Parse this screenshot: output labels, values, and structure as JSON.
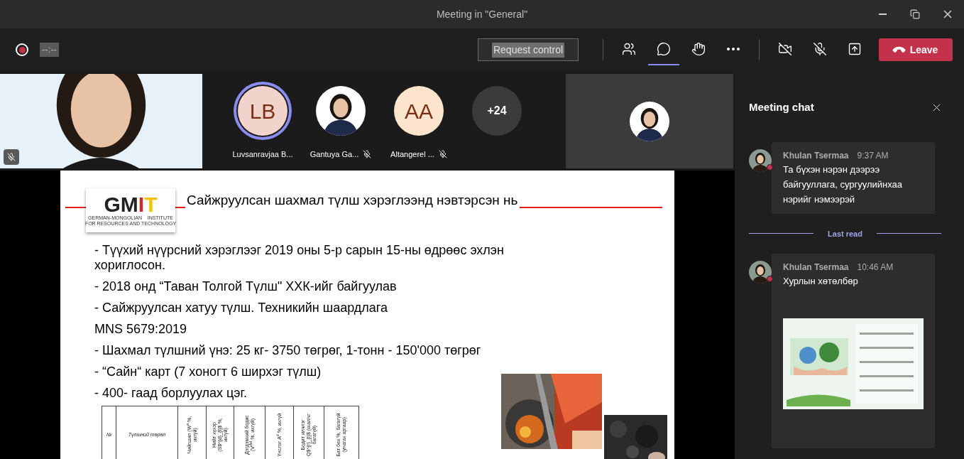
{
  "window": {
    "title": "Meeting in \"General\""
  },
  "toolbar": {
    "recording": true,
    "timer": "--:--",
    "request_control": "Request control",
    "buttons": [
      {
        "kind": "people",
        "selected": false
      },
      {
        "kind": "chat",
        "selected": true
      },
      {
        "kind": "reactions",
        "selected": false
      },
      {
        "kind": "more",
        "selected": false
      },
      {
        "kind": "camera-off",
        "selected": false
      },
      {
        "kind": "mic-off",
        "selected": false
      },
      {
        "kind": "share",
        "selected": false
      }
    ],
    "leave": "Leave"
  },
  "participants": [
    {
      "kind": "video",
      "muted": true
    },
    {
      "kind": "initials",
      "initials": "LB",
      "name": "Luvsanravjaa B...",
      "speaking": true,
      "muted": false,
      "color": "#f1d3cb"
    },
    {
      "name": "Gantuya Ga...",
      "speaking": false,
      "muted": true
    },
    {
      "kind": "initials",
      "initials": "AA",
      "name": "Altangerel ...",
      "speaking": false,
      "muted": true,
      "color": "#fde4cd"
    },
    {
      "kind": "overflow",
      "count": "+24"
    }
  ],
  "slide": {
    "logo_text": "GMIT",
    "logo_caption": [
      "GERMAN-MONGOLIAN    INSTITUTE",
      "FOR RESOURCES AND TECHNOLOGY"
    ],
    "title": "Сайжруулсан шахмал түлш хэрэглээнд нэвтэрсэн нь",
    "bullets": [
      "- Түүхий нүүрсний хэрэглээг 2019 оны 5-р сарын 15-ны өдрөөс эхлэн хориглосон.",
      "- 2018 онд “Таван Толгой Түлш\" ХХК-ийг байгуулав",
      "- Сайжруулсан хатуу түлш. Техникийн шаардлага",
      "MNS 5679:2019",
      "- Шахмал түлшний үнэ: 25 кг- 3750 төгрөг, 1-тонн - 150'000 төгрөг",
      "- “Сайн“ карт (7 хоногт 6 ширхэг түлш)",
      "- 400- гаад борлуулах цэг."
    ],
    "table": {
      "columns": [
        "№",
        "Түлшний төрөл",
        "Чийгшил (W$^{a}$ %, ихгүй)",
        "Нийт хүхэр (S$^{d}_{t}$ %, ихгүй)",
        "Дэгдэмхий бодис (V$^{daf}$ %, ихгүй)",
        "Үнслэг A$^{d}$ %, ихгүй",
        "Бодит илчлэг Q$^{r}_{i}$ (ккал/кг багагүй)",
        "Бат бөх %, багагүй (унагах аргаар)"
      ]
    }
  },
  "chat": {
    "title": "Meeting chat",
    "messages": [
      {
        "author": "Khulan Tsermaa",
        "time": "9:37 AM",
        "text": "Та бүхэн нэрэн дээрээ байгууллага, сургуулийнхаа нэрийг нэмээрэй",
        "attachment": false
      },
      {
        "kind": "divider",
        "label": "Last read"
      },
      {
        "author": "Khulan Tsermaa",
        "time": "10:46 AM",
        "text": "Хурлын хөтөлбөр",
        "attachment": true
      }
    ]
  }
}
